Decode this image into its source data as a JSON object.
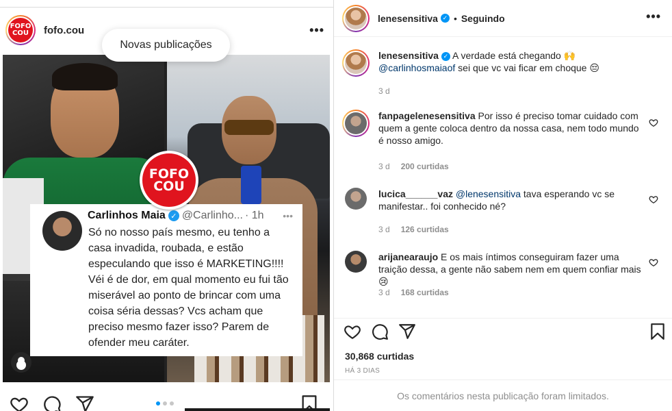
{
  "feed": {
    "username": "fofo.cou",
    "avatar_text": "FOFO COU",
    "new_posts_label": "Novas publicações",
    "more_label": "•••",
    "badge_text": "FOFO COU",
    "tweet": {
      "name": "Carlinhos Maia",
      "handle": "@Carlinho...",
      "time": "· 1h",
      "more": "•••",
      "text": "Só no nosso país mesmo, eu tenho a casa invadida, roubada, e estão especulando que isso é MARKETING!!!! Véi é de dor, em qual momento eu fui tão miserável ao ponto de brincar com uma coisa séria dessas? Vcs acham que preciso mesmo fazer isso? Parem de ofender meu caráter."
    },
    "carousel": {
      "total": 3,
      "active": 1
    }
  },
  "panel": {
    "header": {
      "username": "lenesensitiva",
      "separator": "•",
      "follow_status": "Seguindo",
      "more_label": "•••"
    },
    "comments": [
      {
        "user": "lenesensitiva",
        "verified": true,
        "text_before": " A verdade está chegando 🙌 ",
        "mention": "@carlinhosmaiaof",
        "text_after": " sei que vc vai ficar em choque 😔",
        "time": "3 d",
        "likes": ""
      },
      {
        "user": "fanpagelenesensitiva",
        "text_before": " Por isso é preciso tomar cuidado com quem a gente coloca dentro da nossa casa, nem todo mundo é nosso amigo.",
        "mention": "",
        "text_after": "",
        "time": "3 d",
        "likes": "200 curtidas"
      },
      {
        "user": "lucica______vaz",
        "text_before": " ",
        "mention": "@lenesensitiva",
        "text_after": " tava esperando vc se manifestar.. foi conhecido né?",
        "time": "3 d",
        "likes": "126 curtidas"
      },
      {
        "user": "arijanearaujo",
        "text_before": " E os mais íntimos conseguiram fazer uma traição dessa, a gente não sabem nem em quem confiar mais😢",
        "mention": "",
        "text_after": "",
        "time": "3 d",
        "likes": "168 curtidas"
      }
    ],
    "likes_count": "30,868 curtidas",
    "post_date": "HÁ 3 DIAS",
    "limited_notice": "Os comentários nesta publicação foram limitados."
  },
  "icons": {
    "heart": "heart-icon",
    "comment": "comment-icon",
    "share": "share-icon",
    "save": "bookmark-icon",
    "verified": "verified-badge-icon",
    "user_tag": "user-tag-icon"
  },
  "colors": {
    "link": "#00376b",
    "verified": "#0095f6",
    "muted": "#8e8e8e",
    "brand_red": "#e0141e"
  }
}
